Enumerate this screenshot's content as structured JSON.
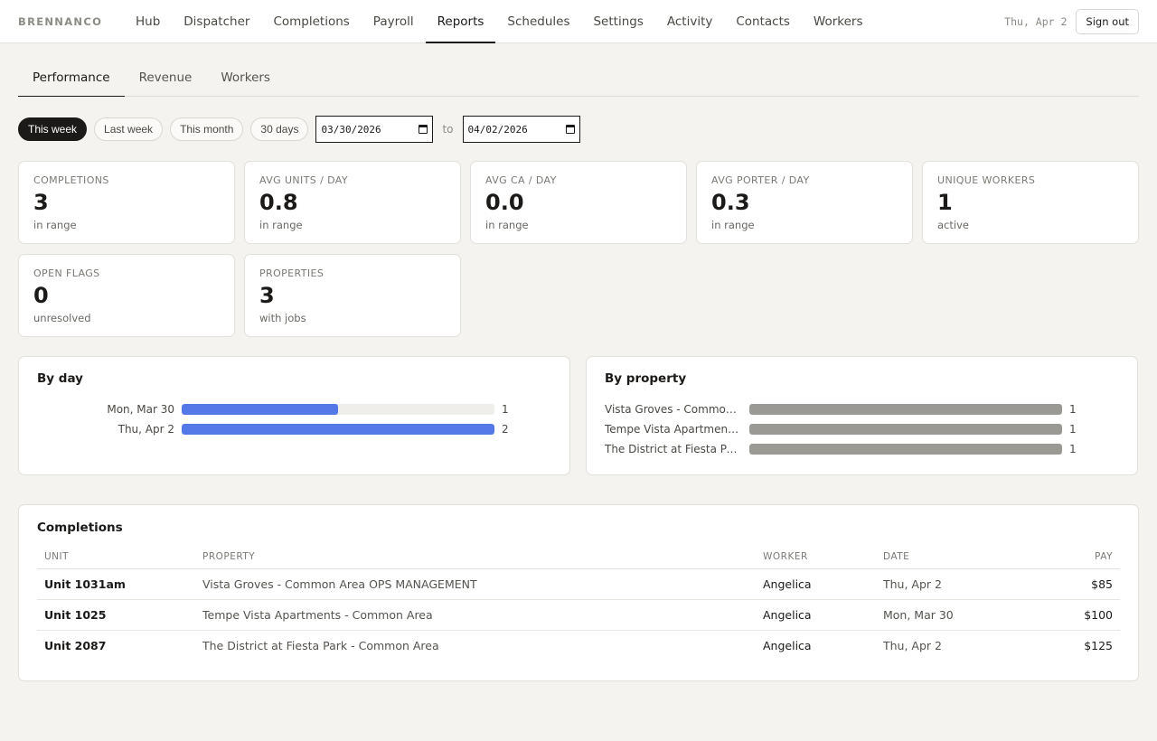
{
  "brand": "BRENNANCO",
  "nav": [
    {
      "label": "Hub",
      "active": false
    },
    {
      "label": "Dispatcher",
      "active": false
    },
    {
      "label": "Completions",
      "active": false
    },
    {
      "label": "Payroll",
      "active": false
    },
    {
      "label": "Reports",
      "active": true
    },
    {
      "label": "Schedules",
      "active": false
    },
    {
      "label": "Settings",
      "active": false
    },
    {
      "label": "Activity",
      "active": false
    },
    {
      "label": "Contacts",
      "active": false
    },
    {
      "label": "Workers",
      "active": false
    }
  ],
  "header": {
    "date": "Thu, Apr 2",
    "sign_out": "Sign out"
  },
  "subtabs": [
    {
      "label": "Performance",
      "active": true
    },
    {
      "label": "Revenue",
      "active": false
    },
    {
      "label": "Workers",
      "active": false
    }
  ],
  "filters": {
    "presets": [
      {
        "label": "This week",
        "active": true
      },
      {
        "label": "Last week",
        "active": false
      },
      {
        "label": "This month",
        "active": false
      },
      {
        "label": "30 days",
        "active": false
      }
    ],
    "from": "03/30/2026",
    "to_label": "to",
    "to": "04/02/2026"
  },
  "stats": [
    {
      "label": "COMPLETIONS",
      "value": "3",
      "sub": "in range"
    },
    {
      "label": "AVG UNITS / DAY",
      "value": "0.8",
      "sub": "in range"
    },
    {
      "label": "AVG CA / DAY",
      "value": "0.0",
      "sub": "in range"
    },
    {
      "label": "AVG PORTER / DAY",
      "value": "0.3",
      "sub": "in range"
    },
    {
      "label": "UNIQUE WORKERS",
      "value": "1",
      "sub": "active"
    },
    {
      "label": "OPEN FLAGS",
      "value": "0",
      "sub": "unresolved"
    },
    {
      "label": "PROPERTIES",
      "value": "3",
      "sub": "with jobs"
    }
  ],
  "by_day": {
    "title": "By day",
    "color": "#5578e8",
    "max": 2,
    "rows": [
      {
        "label": "Mon, Mar 30",
        "value": 1
      },
      {
        "label": "Thu, Apr 2",
        "value": 2
      }
    ]
  },
  "by_property": {
    "title": "By property",
    "color": "#9a9993",
    "max": 1,
    "rows": [
      {
        "label": "Vista Groves - Common Ar...",
        "value": 1
      },
      {
        "label": "Tempe Vista Apartments - ...",
        "value": 1
      },
      {
        "label": "The District at Fiesta Park -...",
        "value": 1
      }
    ]
  },
  "completions": {
    "title": "Completions",
    "columns": [
      "UNIT",
      "PROPERTY",
      "WORKER",
      "DATE",
      "PAY"
    ],
    "rows": [
      {
        "unit": "Unit 1031am",
        "property": "Vista Groves - Common Area OPS MANAGEMENT",
        "worker": "Angelica",
        "date": "Thu, Apr 2",
        "pay": "$85"
      },
      {
        "unit": "Unit 1025",
        "property": "Tempe Vista Apartments - Common Area",
        "worker": "Angelica",
        "date": "Mon, Mar 30",
        "pay": "$100"
      },
      {
        "unit": "Unit 2087",
        "property": "The District at Fiesta Park - Common Area",
        "worker": "Angelica",
        "date": "Thu, Apr 2",
        "pay": "$125"
      }
    ]
  }
}
